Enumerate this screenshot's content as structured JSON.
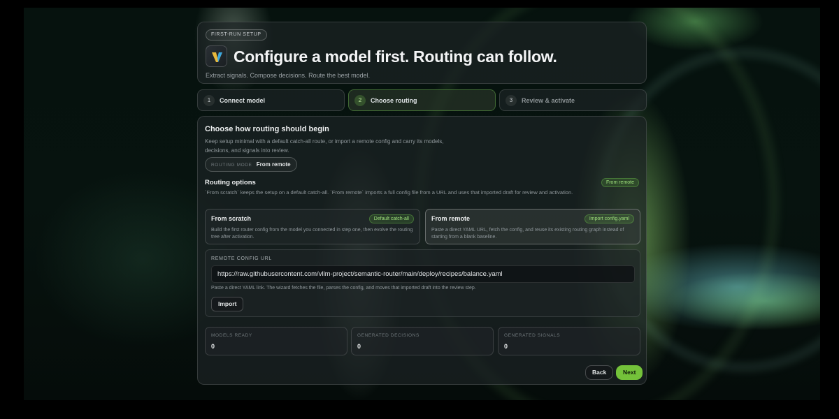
{
  "header": {
    "tag": "FIRST-RUN SETUP",
    "title": "Configure a model first. Routing can follow.",
    "subtitle": "Extract signals. Compose decisions. Route the best model."
  },
  "steps": [
    {
      "num": "1",
      "label": "Connect model"
    },
    {
      "num": "2",
      "label": "Choose routing"
    },
    {
      "num": "3",
      "label": "Review & activate"
    }
  ],
  "routing": {
    "heading": "Choose how routing should begin",
    "description": "Keep setup minimal with a default catch-all route, or import a remote config and carry its models, decisions, and signals into review.",
    "mode_key": "ROUTING MODE",
    "mode_value": "From remote",
    "options_heading": "Routing options",
    "options_badge": "From remote",
    "options_description": "`From scratch` keeps the setup on a default catch-all. `From remote` imports a full config file from a URL and uses that imported draft for review and activation.",
    "cards": [
      {
        "title": "From scratch",
        "badge": "Default catch-all",
        "description": "Build the first router config from the model you connected in step one, then evolve the routing tree after activation."
      },
      {
        "title": "From remote",
        "badge": "Import config.yaml",
        "description": "Paste a direct YAML URL, fetch the config, and reuse its existing routing graph instead of starting from a blank baseline."
      }
    ],
    "remote": {
      "label": "REMOTE CONFIG URL",
      "url": "https://raw.githubusercontent.com/vllm-project/semantic-router/main/deploy/recipes/balance.yaml",
      "hint": "Paste a direct YAML link. The wizard fetches the file, parses the config, and moves that imported draft into the review step.",
      "import_label": "Import"
    },
    "stats": [
      {
        "label": "MODELS READY",
        "value": "0"
      },
      {
        "label": "GENERATED DECISIONS",
        "value": "0"
      },
      {
        "label": "GENERATED SIGNALS",
        "value": "0"
      }
    ],
    "back_label": "Back",
    "next_label": "Next"
  },
  "colors": {
    "accent": "#74c23a",
    "badge_text": "#9fe07c"
  }
}
